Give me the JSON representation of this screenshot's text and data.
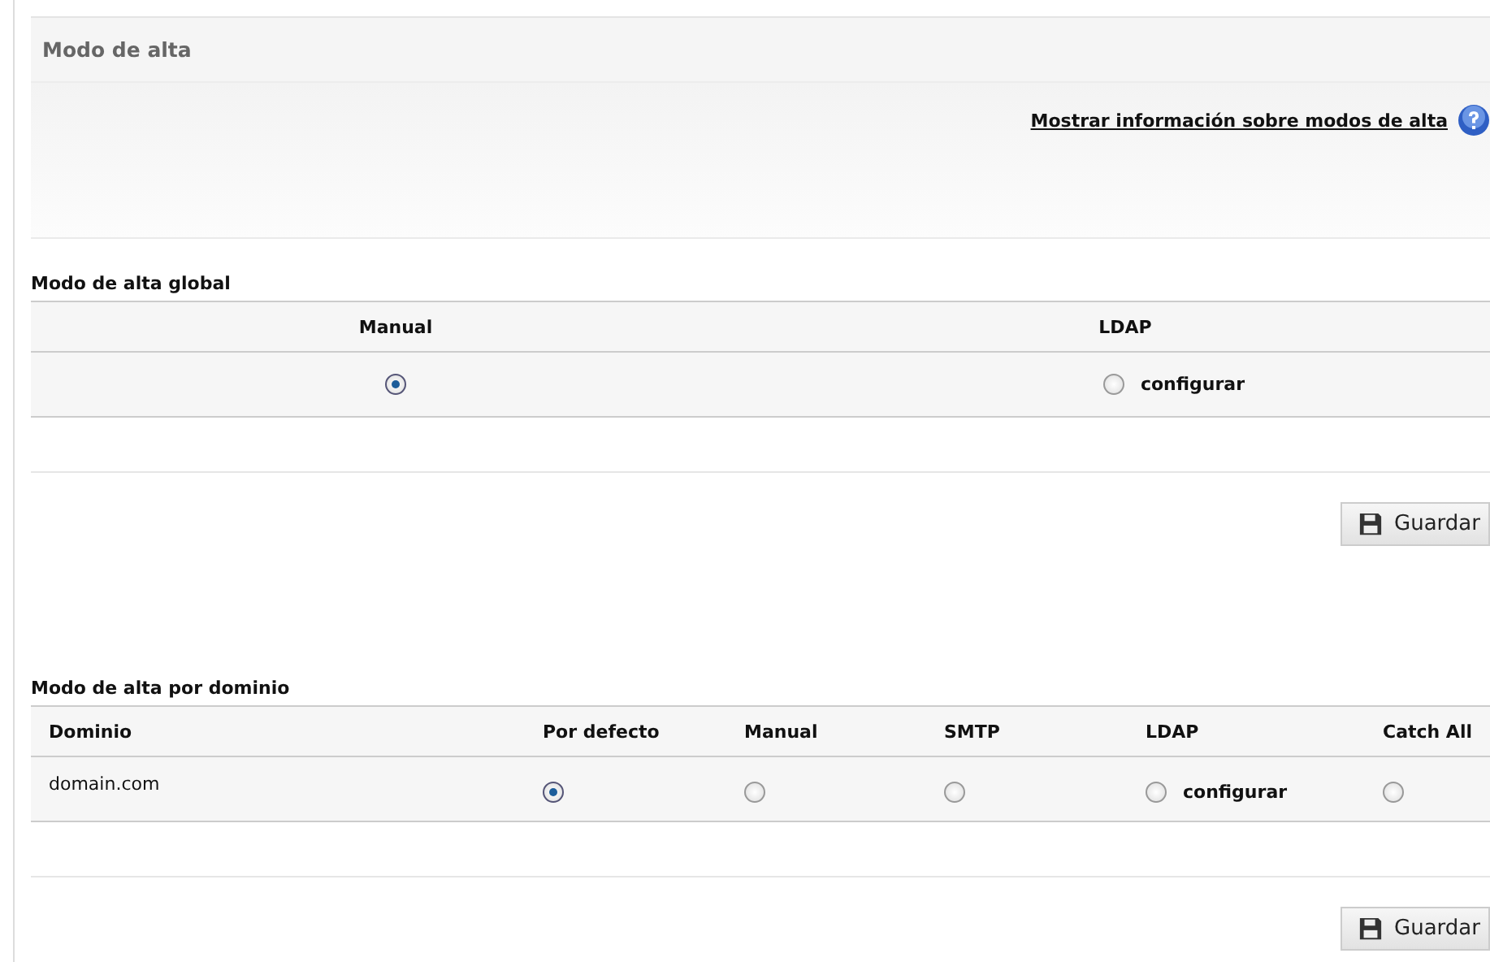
{
  "panel": {
    "title": "Modo de alta",
    "info_link": "Mostrar información sobre modos de alta"
  },
  "global": {
    "title": "Modo de alta global",
    "columns": [
      "Manual",
      "LDAP"
    ],
    "options": [
      {
        "selected": true
      },
      {
        "selected": false,
        "link": "configurar"
      }
    ],
    "save_button": "Guardar"
  },
  "domain": {
    "title": "Modo de alta por dominio",
    "columns": [
      "Dominio",
      "Por defecto",
      "Manual",
      "SMTP",
      "LDAP",
      "Catch All"
    ],
    "rows": [
      {
        "domain": "domain.com",
        "options": [
          {
            "selected": true
          },
          {
            "selected": false
          },
          {
            "selected": false
          },
          {
            "selected": false,
            "link": "configurar"
          },
          {
            "selected": false
          }
        ]
      }
    ],
    "save_button": "Guardar"
  }
}
